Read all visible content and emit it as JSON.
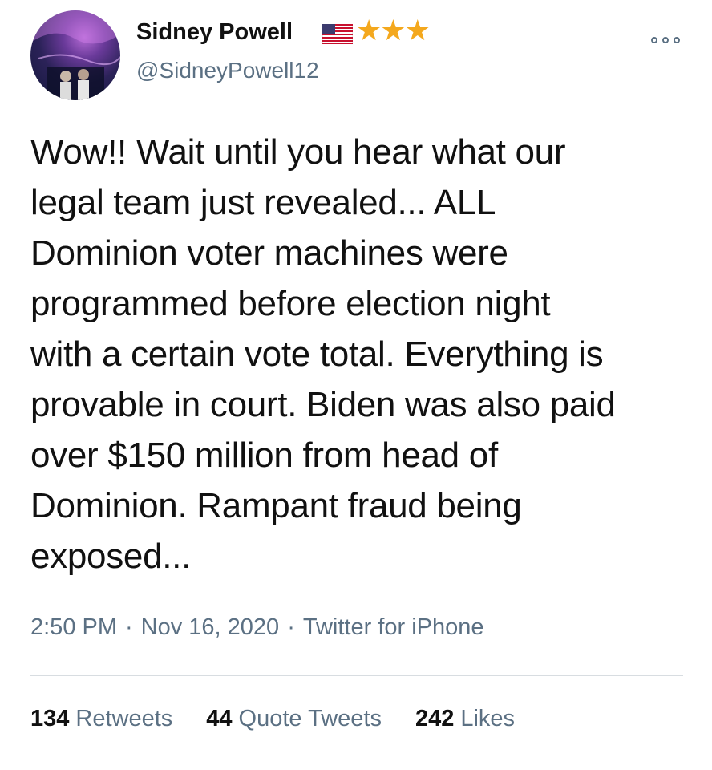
{
  "tweet": {
    "author": {
      "display_name": "Sidney Powell",
      "handle": "@SidneyPowell12",
      "badges": [
        "us-flag-icon",
        "star-icon",
        "star-icon",
        "star-icon"
      ]
    },
    "more_icon": "more-options-icon",
    "text": "Wow!! Wait until you hear what our\nlegal team just revealed... ALL\nDominion voter machines were\nprogrammed before election night\nwith a certain vote total. Everything is\nprovable in court. Biden was also paid\nover $150 million from head of\nDominion. Rampant fraud being\nexposed...",
    "meta": {
      "time": "2:50 PM",
      "date": "Nov 16, 2020",
      "source": "Twitter for iPhone",
      "separator": "·"
    },
    "stats": {
      "retweets": {
        "count": "134",
        "label": "Retweets"
      },
      "quotes": {
        "count": "44",
        "label": "Quote Tweets"
      },
      "likes": {
        "count": "242",
        "label": "Likes"
      }
    }
  },
  "colors": {
    "text": "#111111",
    "secondary": "#5b7083",
    "star": "#f4a81d",
    "divider": "#d8dde1"
  }
}
